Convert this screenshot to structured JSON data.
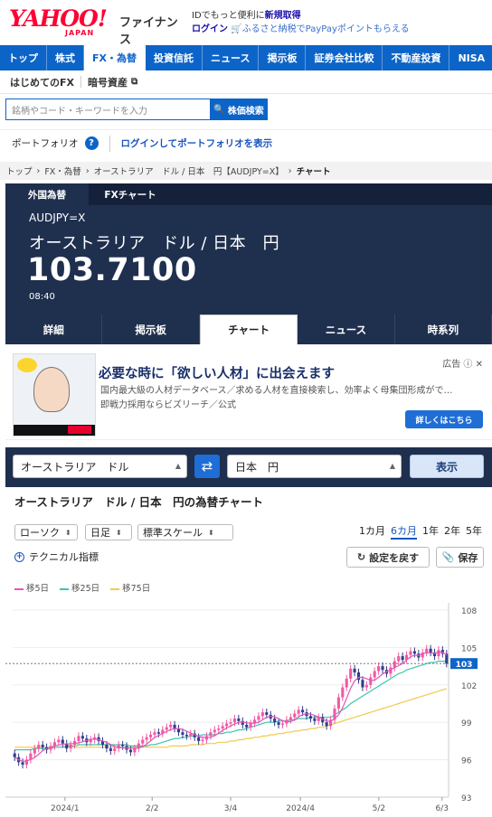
{
  "header": {
    "logo_text": "YAHOO!",
    "logo_sub": "JAPAN",
    "service": "ファイナンス",
    "line1_prefix": "IDでもっと便利に",
    "line1_link": "新規取得",
    "login": "ログイン",
    "line2": "ふるさと納税でPayPayポイントもらえる"
  },
  "nav": [
    "トップ",
    "株式",
    "FX・為替",
    "投資信託",
    "ニュース",
    "掲示板",
    "証券会社比較",
    "不動産投資",
    "NISA"
  ],
  "nav_active": "FX・為替",
  "subnav": [
    "はじめてのFX",
    "暗号資産"
  ],
  "search": {
    "placeholder": "銘柄やコード・キーワードを入力",
    "button": "株価検索"
  },
  "portfolio": {
    "label": "ポートフォリオ",
    "help": "?",
    "login_link": "ログインしてポートフォリオを表示"
  },
  "breadcrumb": [
    "トップ",
    "FX・為替",
    "オーストラリア　ドル / 日本　円【AUDJPY=X】",
    "チャート"
  ],
  "quote": {
    "tabs": [
      "外国為替",
      "FXチャート"
    ],
    "symbol": "AUDJPY=X",
    "name": "オーストラリア　ドル / 日本　円",
    "price": "103.7100",
    "time": "08:40"
  },
  "detail_tabs": [
    "詳細",
    "掲示板",
    "チャート",
    "ニュース",
    "時系列"
  ],
  "detail_active": "チャート",
  "ad": {
    "headline": "必要な時に「欲しい人材」に出会えます",
    "desc": "国内最大級の人材データベース／求める人材を直接検索し、効率よく母集団形成がで…",
    "source": "即戦力採用ならビズリーチ／公式",
    "label": "広告",
    "cta": "詳しくはこちら",
    "image_brand": "BIZREACH"
  },
  "pair": {
    "from": "オーストラリア　ドル",
    "to": "日本　円",
    "show": "表示"
  },
  "chart_title": "オーストラリア　ドル / 日本　円の為替チャート",
  "controls": {
    "type": "ローソク",
    "interval": "日足",
    "scale": "標準スケール"
  },
  "periods": [
    "1カ月",
    "6カ月",
    "1年",
    "2年",
    "5年"
  ],
  "period_active": "6カ月",
  "technical": "テクニカル指標",
  "reset": "設定を戻す",
  "save": "保存",
  "colors": {
    "ma5": "#e256b8",
    "ma25": "#3cc6b0",
    "ma75": "#f2c94c",
    "up": "#ef5ba1",
    "down": "#2f3c8c",
    "accent": "#0d64c8"
  },
  "chart_data": {
    "type": "candlestick",
    "legend": [
      "移5日",
      "移25日",
      "移75日"
    ],
    "y_ticks": [
      108,
      105,
      102,
      99,
      96,
      93
    ],
    "ylim": [
      93,
      108
    ],
    "x_ticks": [
      "2024/1",
      "2/2",
      "3/4",
      "2024/4",
      "5/2",
      "6/3"
    ],
    "last_price_label": "103",
    "last_price": 103.71,
    "closes": [
      96.2,
      95.8,
      95.6,
      96.0,
      96.5,
      96.9,
      97.2,
      97.0,
      96.8,
      97.1,
      97.4,
      97.6,
      97.3,
      96.9,
      97.2,
      97.5,
      97.9,
      97.7,
      97.4,
      97.6,
      97.8,
      97.5,
      97.2,
      96.9,
      96.7,
      96.9,
      97.2,
      97.1,
      96.8,
      96.6,
      96.9,
      97.3,
      97.6,
      97.8,
      98.0,
      98.2,
      98.1,
      98.4,
      98.6,
      98.8,
      98.5,
      98.2,
      98.0,
      97.9,
      98.1,
      97.8,
      97.5,
      97.6,
      97.9,
      98.2,
      98.4,
      98.5,
      98.7,
      98.9,
      99.0,
      99.3,
      99.1,
      98.8,
      98.6,
      98.9,
      99.2,
      99.5,
      99.8,
      99.6,
      99.3,
      99.0,
      98.8,
      98.9,
      99.2,
      99.4,
      99.7,
      100.0,
      99.8,
      99.5,
      99.3,
      99.1,
      99.4,
      99.0,
      98.7,
      99.2,
      100.1,
      101.0,
      101.8,
      102.5,
      103.3,
      103.0,
      102.4,
      101.8,
      102.0,
      102.6,
      103.1,
      103.5,
      103.2,
      102.9,
      103.4,
      103.9,
      104.3,
      104.0,
      104.4,
      104.7,
      104.5,
      104.2,
      104.6,
      104.9,
      104.6,
      104.3,
      104.8,
      104.5,
      103.7
    ],
    "ma25": [
      96.8,
      96.8,
      96.8,
      96.8,
      96.8,
      96.9,
      96.9,
      96.9,
      96.9,
      96.9,
      97.0,
      97.0,
      97.0,
      97.1,
      97.1,
      97.1,
      97.2,
      97.2,
      97.2,
      97.2,
      97.2,
      97.2,
      97.2,
      97.2,
      97.2,
      97.2,
      97.2,
      97.2,
      97.2,
      97.1,
      97.1,
      97.1,
      97.1,
      97.1,
      97.2,
      97.2,
      97.3,
      97.4,
      97.5,
      97.6,
      97.7,
      97.7,
      97.8,
      97.8,
      97.9,
      97.9,
      97.9,
      98.0,
      98.0,
      98.0,
      98.0,
      98.1,
      98.1,
      98.2,
      98.2,
      98.3,
      98.4,
      98.4,
      98.5,
      98.6,
      98.7,
      98.8,
      98.9,
      99.0,
      99.0,
      99.0,
      99.1,
      99.1,
      99.1,
      99.2,
      99.2,
      99.3,
      99.3,
      99.3,
      99.4,
      99.4,
      99.4,
      99.4,
      99.4,
      99.4,
      99.6,
      99.8,
      100.0,
      100.2,
      100.5,
      100.7,
      100.9,
      101.1,
      101.3,
      101.5,
      101.7,
      101.9,
      102.1,
      102.3,
      102.5,
      102.7,
      102.9,
      103.0,
      103.2,
      103.3,
      103.4,
      103.5,
      103.6,
      103.7,
      103.8,
      103.8,
      103.9,
      103.9,
      103.9
    ],
    "ma75": [
      97.0,
      97.0,
      97.0,
      97.0,
      97.0,
      97.0,
      97.0,
      97.0,
      97.0,
      97.0,
      97.0,
      97.0,
      97.0,
      97.0,
      97.0,
      97.0,
      97.0,
      97.0,
      97.0,
      97.0,
      97.0,
      97.0,
      97.0,
      97.0,
      97.0,
      97.0,
      97.0,
      97.0,
      97.0,
      97.0,
      97.0,
      97.0,
      97.0,
      97.0,
      97.0,
      97.0,
      97.0,
      97.0,
      97.0,
      97.1,
      97.1,
      97.1,
      97.1,
      97.1,
      97.2,
      97.2,
      97.2,
      97.2,
      97.3,
      97.3,
      97.3,
      97.4,
      97.4,
      97.4,
      97.5,
      97.5,
      97.6,
      97.6,
      97.7,
      97.7,
      97.8,
      97.8,
      97.9,
      97.9,
      98.0,
      98.0,
      98.1,
      98.1,
      98.2,
      98.2,
      98.3,
      98.3,
      98.4,
      98.4,
      98.5,
      98.5,
      98.6,
      98.6,
      98.7,
      98.8,
      98.9,
      99.0,
      99.1,
      99.2,
      99.3,
      99.4,
      99.5,
      99.6,
      99.7,
      99.8,
      99.9,
      100.0,
      100.1,
      100.2,
      100.3,
      100.4,
      100.5,
      100.6,
      100.7,
      100.8,
      100.9,
      101.0,
      101.1,
      101.2,
      101.3,
      101.4,
      101.5,
      101.6,
      101.7
    ]
  }
}
